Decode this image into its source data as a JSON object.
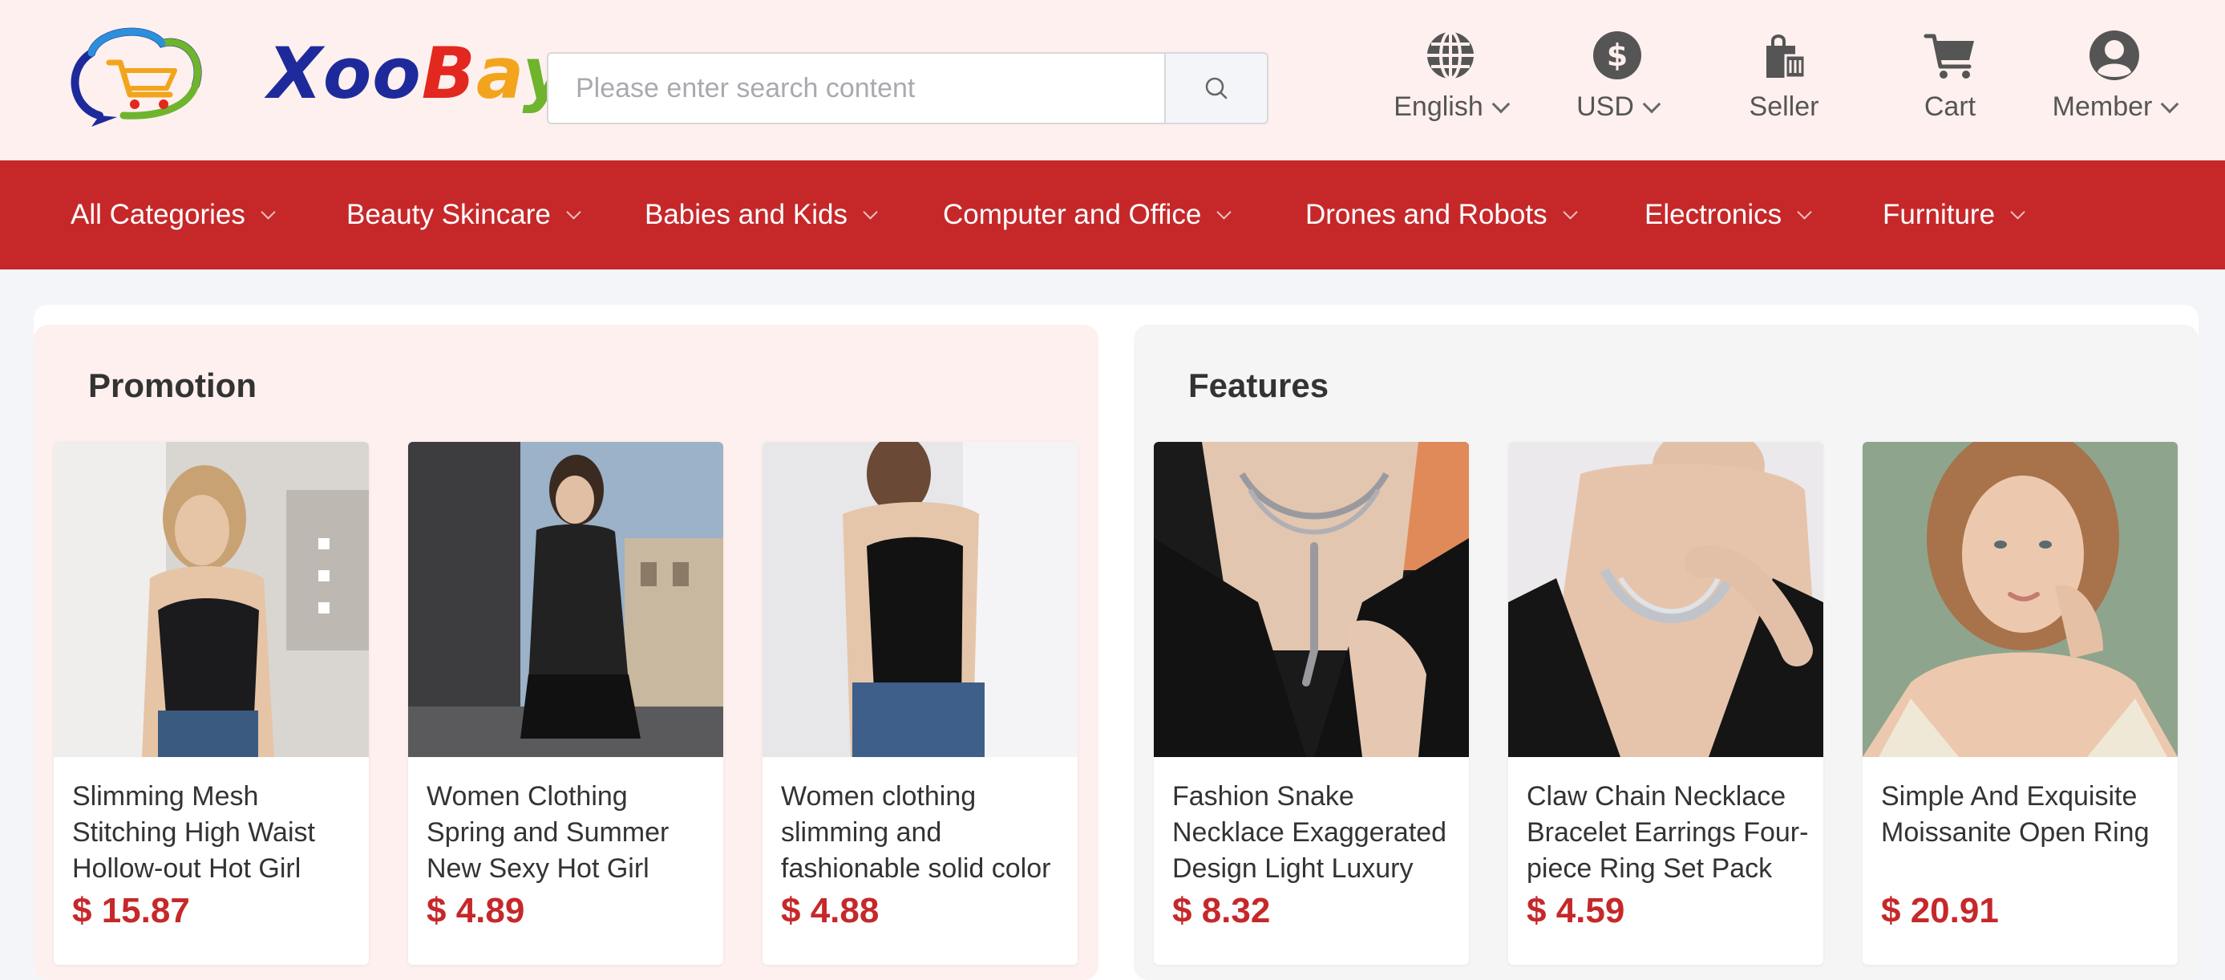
{
  "header": {
    "logo": {
      "text_parts": [
        "Xoo",
        "B",
        "a",
        "y"
      ]
    },
    "search": {
      "placeholder": "Please enter search content"
    },
    "items": [
      {
        "label": "English",
        "icon": "globe-icon",
        "has_dropdown": true
      },
      {
        "label": "USD",
        "icon": "dollar-icon",
        "has_dropdown": true
      },
      {
        "label": "Seller",
        "icon": "seller-bag-icon",
        "has_dropdown": false
      },
      {
        "label": "Cart",
        "icon": "cart-icon",
        "has_dropdown": false
      },
      {
        "label": "Member",
        "icon": "user-avatar-icon",
        "has_dropdown": true
      }
    ]
  },
  "nav": {
    "items": [
      {
        "label": "All Categories"
      },
      {
        "label": "Beauty Skincare"
      },
      {
        "label": "Babies and Kids"
      },
      {
        "label": "Computer and Office"
      },
      {
        "label": "Drones and Robots"
      },
      {
        "label": "Electronics"
      },
      {
        "label": "Furniture"
      }
    ]
  },
  "promotion": {
    "title": "Promotion",
    "products": [
      {
        "name": "Slimming Mesh Stitching High Waist Hollow-out Hot Girl",
        "price": "$ 15.87"
      },
      {
        "name": "Women Clothing Spring and Summer New Sexy Hot Girl",
        "price": "$ 4.89"
      },
      {
        "name": "Women clothing slimming and fashionable solid color",
        "price": "$ 4.88"
      }
    ]
  },
  "features": {
    "title": "Features",
    "products": [
      {
        "name": "Fashion Snake Necklace Exaggerated Design Light Luxury",
        "price": "$ 8.32"
      },
      {
        "name": "Claw Chain Necklace Bracelet Earrings Four-piece Ring Set Pack",
        "price": "$ 4.59"
      },
      {
        "name": "Simple And Exquisite Moissanite Open Ring",
        "price": "$ 20.91"
      }
    ]
  },
  "colors": {
    "brand_red": "#c6282a",
    "header_bg": "#fdf0ee",
    "promo_bg": "#fdf0ee",
    "features_bg": "#f5f5f5"
  }
}
